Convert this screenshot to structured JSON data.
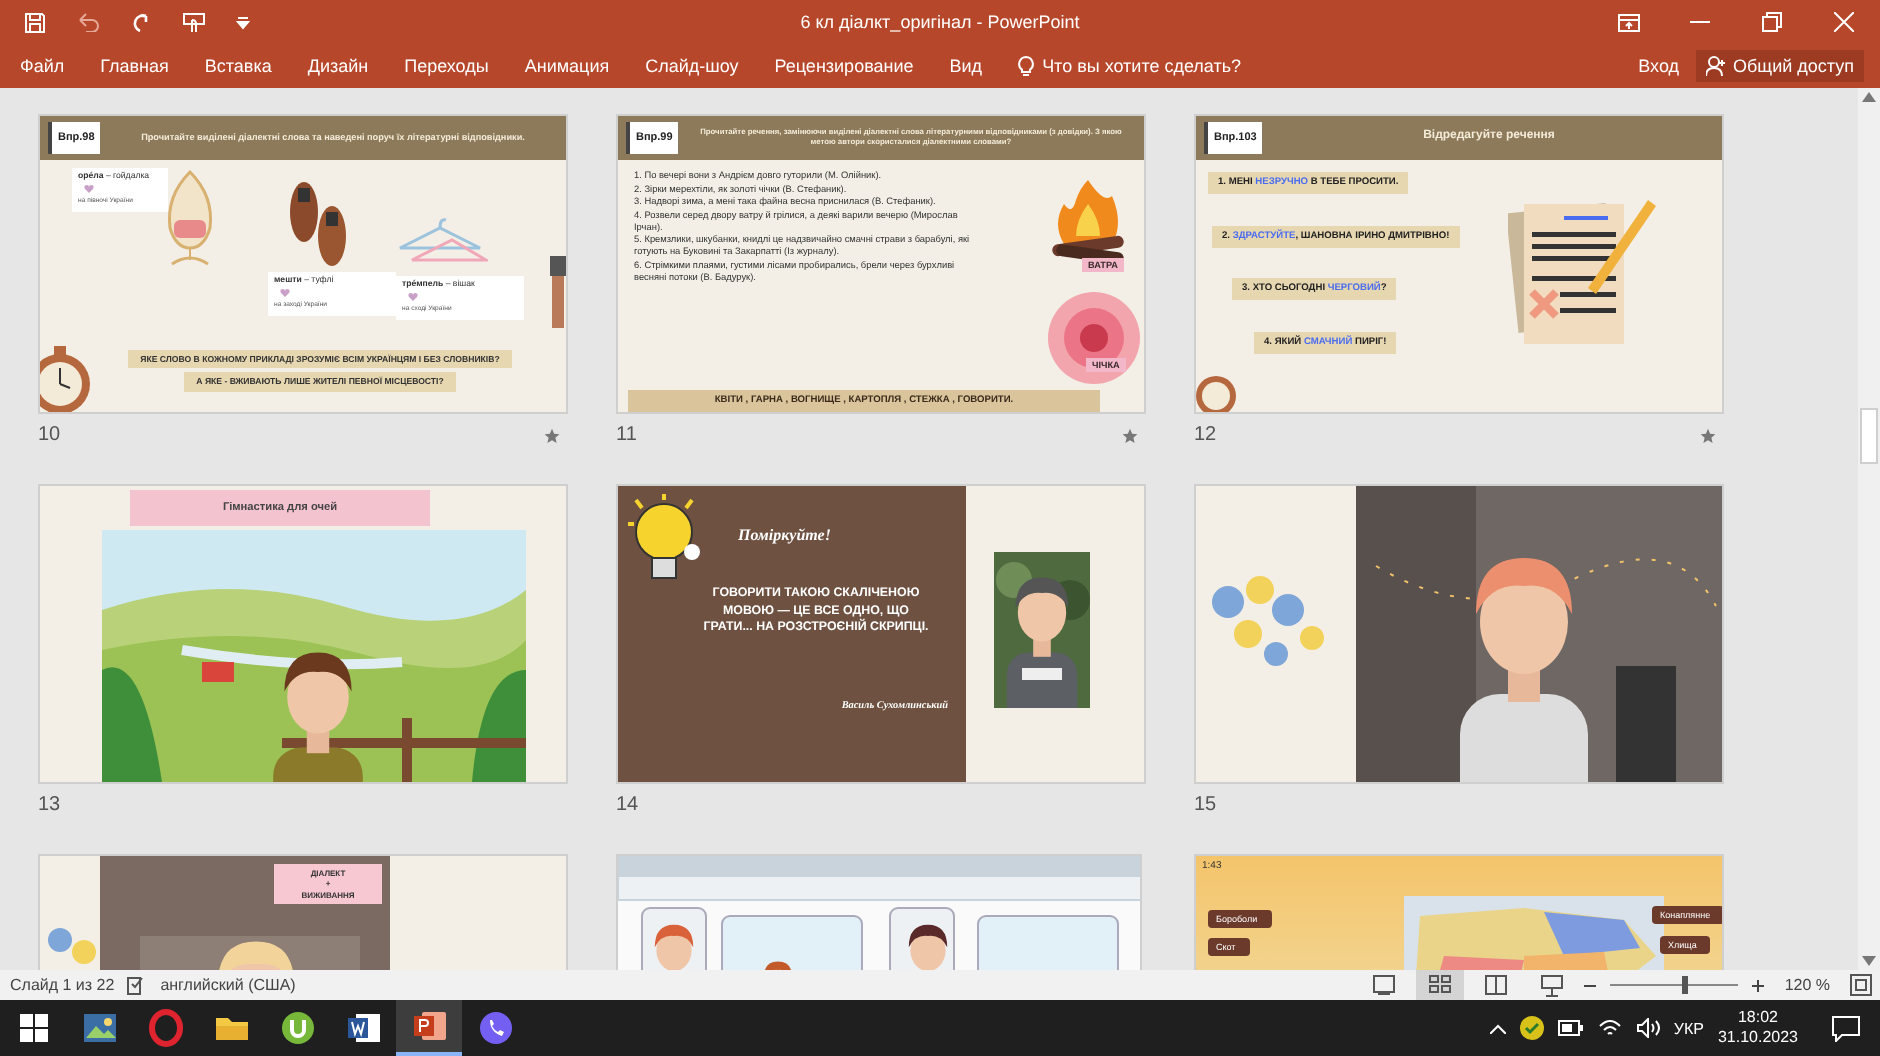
{
  "window": {
    "title": "6 кл діалкт_оригінал - PowerPoint"
  },
  "ribbon": {
    "tabs": [
      {
        "label": "Файл",
        "selected": false
      },
      {
        "label": "Главная",
        "selected": false
      },
      {
        "label": "Вставка",
        "selected": false
      },
      {
        "label": "Дизайн",
        "selected": false
      },
      {
        "label": "Переходы",
        "selected": false
      },
      {
        "label": "Анимация",
        "selected": false
      },
      {
        "label": "Слайд-шоу",
        "selected": false
      },
      {
        "label": "Рецензирование",
        "selected": false
      },
      {
        "label": "Вид",
        "selected": false
      }
    ],
    "tell_me": "Что вы хотите сделать?",
    "sign_in": "Вход",
    "share": "Общий доступ"
  },
  "slides": [
    {
      "number": "10",
      "transition": true,
      "kind": "words",
      "badge": "Впр.98",
      "title": "Прочитайте виділені діалектні слова та наведені поруч їх літературні відповідники.",
      "words": [
        {
          "pair": "**орéла** – гойдалка",
          "region": "на півночі України"
        },
        {
          "pair": "**мешти** – туфлі",
          "region": "на заході України"
        },
        {
          "pair": "**трéмпель** – вішак",
          "region": "на сході України"
        }
      ],
      "questions": [
        "ЯКЕ СЛОВО В КОЖНОМУ ПРИКЛАДІ ЗРОЗУМІЄ ВСІМ УКРАЇНЦЯМ І БЕЗ СЛОВНИКІВ?",
        "А ЯКЕ - ВЖИВАЮТЬ ЛИШЕ ЖИТЕЛІ ПЕВНОЇ МІСЦЕВОСТІ?"
      ]
    },
    {
      "number": "11",
      "transition": true,
      "kind": "sentences",
      "badge": "Впр.99",
      "title": "Прочитайте речення, замінюючи виділені діалектні слова літературними відповідниками (з довідки). З якою метою автори скористалися діалектними словами?",
      "sentences": [
        "1. По вечері вони з Андрієм довго гуторили (М. Олійник).",
        "2. Зірки мерехтіли, як золоті чічки (В. Стефаник).",
        "3. Надворі зима, а мені така файна весна приснилася (В. Стефаник).",
        "4. Розвели серед двору ватру й грілися, а деякі варили вечерю (Мирослав Ірчан).",
        "5. Кремзлики, шкубанки, книдлі це надзвичайно смачні страви з барабулі, які готують на Буковині та Закарпатті (Із журналу).",
        "6. Стрімкими плаями, густими лісами пробирались, брели через бурхливі весняні потоки (В. Бадурук)."
      ],
      "labels": [
        "ВАТРА",
        "ЧІЧКА"
      ],
      "answers": "КВІТИ , ГАРНА , ВОГНИЩЕ , КАРТОПЛЯ , СТЕЖКА , ГОВОРИТИ."
    },
    {
      "number": "12",
      "transition": true,
      "kind": "edit",
      "badge": "Впр.103",
      "title": "Відредагуйте речення",
      "items": [
        {
          "before": "1.  МЕНІ ",
          "highlight": "НЕЗРУЧНО",
          "after": " В ТЕБЕ ПРОСИТИ."
        },
        {
          "before": "2. ",
          "highlight": "ЗДРАСТУЙТЕ",
          "after": ", ШАНОВНА ІРИНО ДМИТРІВНО!"
        },
        {
          "before": "3. ХТО СЬОГОДНІ ",
          "highlight": "ЧЕРГОВИЙ",
          "after": "?"
        },
        {
          "before": "4. ЯКИЙ ",
          "highlight": "СМАЧНИЙ",
          "after": " ПИРІГ!"
        }
      ]
    },
    {
      "number": "13",
      "transition": false,
      "kind": "gymnastics",
      "title": "Гімнастика для очей"
    },
    {
      "number": "14",
      "transition": false,
      "kind": "quote",
      "heading": "Поміркуйте!",
      "quote": "ГОВОРИТИ ТАКОЮ СКАЛІЧЕНОЮ МОВОЮ — ЦЕ ВСЕ ОДНО, ЩО ГРАТИ... НА РОЗСТРОЄНІЙ СКРИПЦІ.",
      "author": "Василь Сухомлинський"
    },
    {
      "number": "15",
      "transition": false,
      "kind": "video"
    },
    {
      "kind": "dialect",
      "lines": [
        "ДІАЛЕКТ",
        "+",
        "ВИЖИВАННЯ"
      ]
    },
    {
      "kind": "subway"
    },
    {
      "kind": "map",
      "timer": "1:43",
      "left_tags": [
        "Бороболи",
        "Скот"
      ],
      "right_tags": [
        "Конаплянне",
        "Хлища"
      ]
    }
  ],
  "status_bar": {
    "slide_info": "Слайд 1 из 22",
    "language": "английский (США)",
    "views": [
      {
        "selected": false
      },
      {
        "selected": true
      },
      {
        "selected": false
      },
      {
        "selected": false
      }
    ],
    "zoom": "120 %",
    "zoom_slider": {
      "level": 0.55
    }
  },
  "taskbar": {
    "apps": [
      {
        "selected": false
      },
      {
        "selected": false
      },
      {
        "selected": false
      },
      {
        "selected": false
      },
      {
        "selected": false
      },
      {
        "selected": true
      },
      {
        "selected": false
      }
    ],
    "keyboard": "УКР",
    "time": "18:02",
    "date": "31.10.2023"
  }
}
